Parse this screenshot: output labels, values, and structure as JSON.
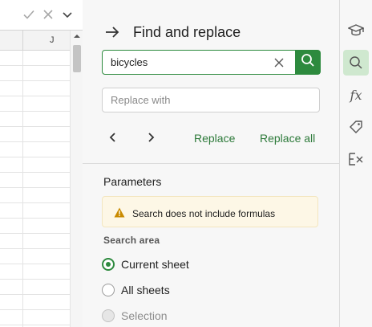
{
  "formula_bar": {
    "confirm_icon": "check-icon",
    "cancel_icon": "close-icon",
    "expand_icon": "chevron-down-icon"
  },
  "sheet": {
    "column_label": "J"
  },
  "panel": {
    "title": "Find and replace",
    "search": {
      "value": "bicycles",
      "placeholder": ""
    },
    "replace": {
      "value": "",
      "placeholder": "Replace with"
    },
    "actions": {
      "prev": "‹",
      "next": "›",
      "replace_label": "Replace",
      "replace_all_label": "Replace all"
    },
    "parameters": {
      "title": "Parameters",
      "warning": "Search does not include formulas",
      "search_area_title": "Search area",
      "options": [
        {
          "label": "Current sheet",
          "state": "checked"
        },
        {
          "label": "All sheets",
          "state": "unchecked"
        },
        {
          "label": "Selection",
          "state": "disabled"
        }
      ]
    }
  },
  "rail": {
    "items": [
      {
        "icon": "graduation-cap-icon"
      },
      {
        "icon": "search-icon",
        "active": true
      },
      {
        "icon": "fx-icon",
        "text": "fx"
      },
      {
        "icon": "tag-icon"
      },
      {
        "icon": "clear-formula-icon"
      }
    ]
  },
  "colors": {
    "accent": "#2d8a3e",
    "active_rail": "#cfe8cf",
    "warning_bg": "#fdf7e6"
  }
}
